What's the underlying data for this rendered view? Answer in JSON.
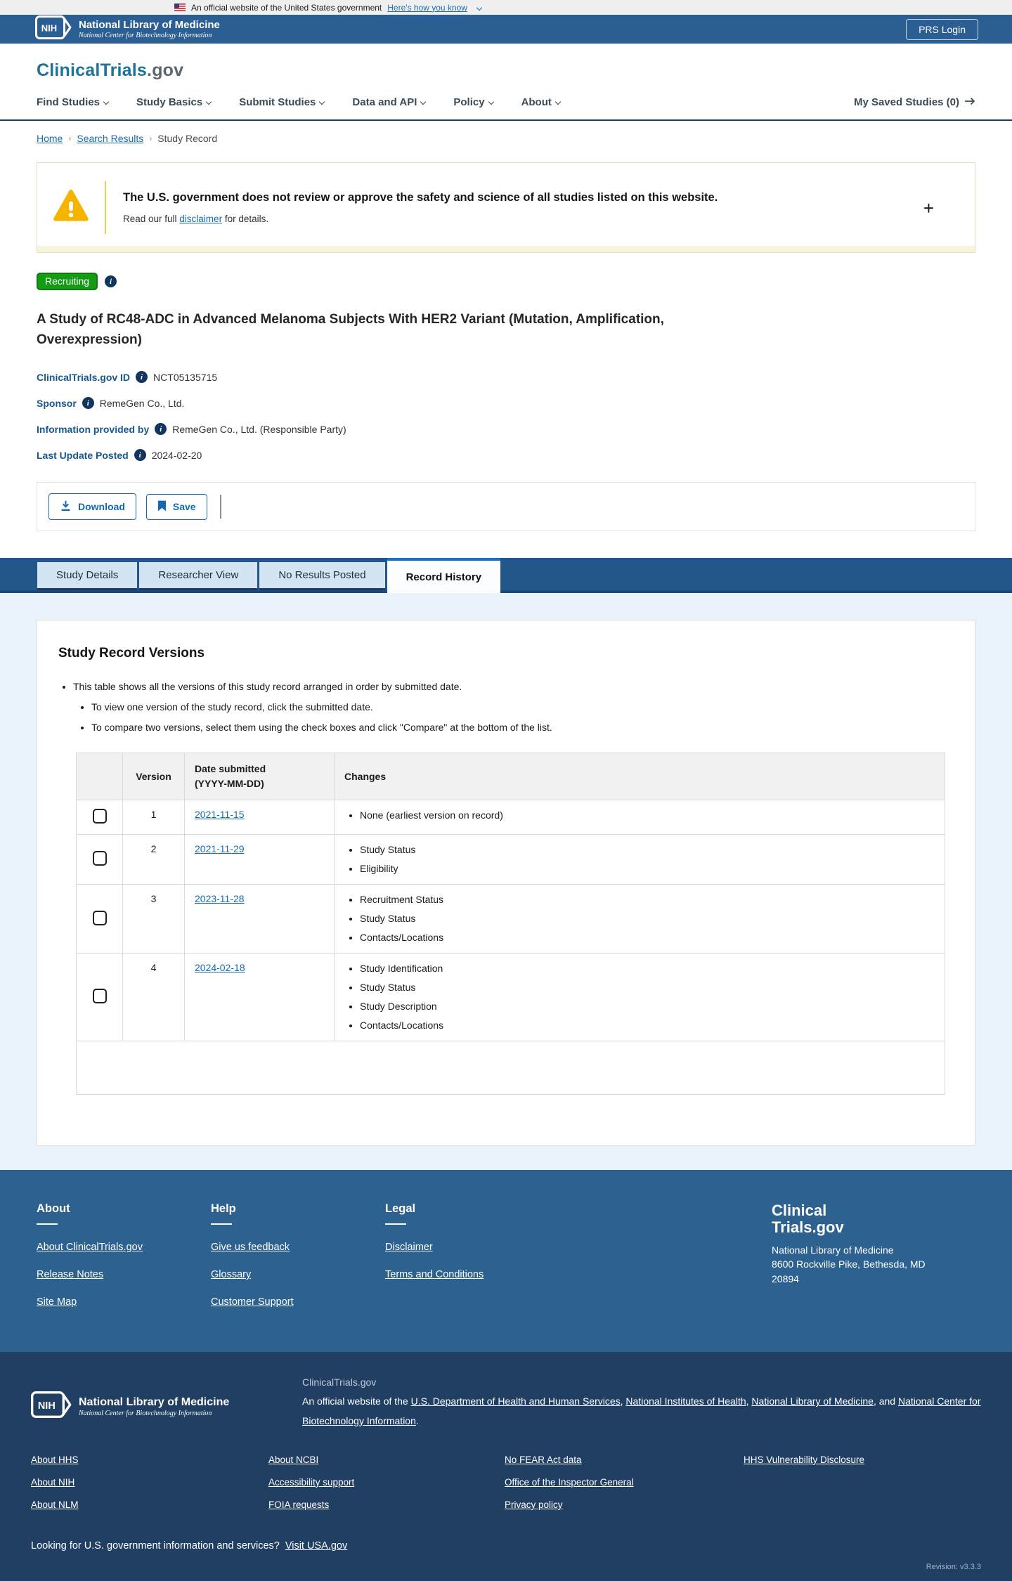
{
  "banner": {
    "text": "An official website of the United States government",
    "link": "Here's how you know"
  },
  "nih_header": {
    "org": "National Library of Medicine",
    "sub": "National Center for Biotechnology Information",
    "login": "PRS Login"
  },
  "brand": {
    "name": "ClinicalTrials",
    "suffix": ".gov"
  },
  "nav": {
    "items": [
      "Find Studies",
      "Study Basics",
      "Submit Studies",
      "Data and API",
      "Policy",
      "About"
    ],
    "saved": "My Saved Studies (0)"
  },
  "breadcrumb": {
    "home": "Home",
    "search": "Search Results",
    "current": "Study Record"
  },
  "alert": {
    "title": "The U.S. government does not review or approve the safety and science of all studies listed on this website.",
    "prefix": "Read our full ",
    "link": "disclaimer",
    "suffix": " for details.",
    "expand": "+"
  },
  "study": {
    "status": "Recruiting",
    "title": "A Study of RC48-ADC in Advanced Melanoma Subjects With HER2 Variant (Mutation, Amplification, Overexpression)",
    "id_label": "ClinicalTrials.gov ID",
    "id_value": "NCT05135715",
    "sponsor_label": "Sponsor",
    "sponsor_value": "RemeGen Co., Ltd.",
    "info_label": "Information provided by",
    "info_value": "RemeGen Co., Ltd. (Responsible Party)",
    "updated_label": "Last Update Posted",
    "updated_value": "2024-02-20"
  },
  "actions": {
    "download": "Download",
    "save": "Save"
  },
  "tabs": {
    "t0": "Study Details",
    "t1": "Researcher View",
    "t2": "No Results Posted",
    "t3": "Record History"
  },
  "record_history": {
    "heading": "Study Record Versions",
    "intro": "This table shows all the versions of this study record arranged in order by submitted date.",
    "sub1": "To view one version of the study record, click the submitted date.",
    "sub2": "To compare two versions, select them using the check boxes and click \"Compare\" at the bottom of the list.",
    "table": {
      "col_version": "Version",
      "col_date_line1": "Date submitted",
      "col_date_line2": "(YYYY-MM-DD)",
      "col_changes": "Changes",
      "rows": [
        {
          "version": "1",
          "date": "2021-11-15",
          "changes": [
            "None (earliest version on record)"
          ]
        },
        {
          "version": "2",
          "date": "2021-11-29",
          "changes": [
            "Study Status",
            "Eligibility"
          ]
        },
        {
          "version": "3",
          "date": "2023-11-28",
          "changes": [
            "Recruitment Status",
            "Study Status",
            "Contacts/Locations"
          ]
        },
        {
          "version": "4",
          "date": "2024-02-18",
          "changes": [
            "Study Identification",
            "Study Status",
            "Study Description",
            "Contacts/Locations"
          ]
        }
      ]
    }
  },
  "footer": {
    "about": {
      "heading": "About",
      "l0": "About ClinicalTrials.gov",
      "l1": "Release Notes",
      "l2": "Site Map"
    },
    "help": {
      "heading": "Help",
      "l0": "Give us feedback",
      "l1": "Glossary",
      "l2": "Customer Support"
    },
    "legal": {
      "heading": "Legal",
      "l0": "Disclaimer",
      "l1": "Terms and Conditions"
    },
    "brand": {
      "line1": "Clinical",
      "line2": "Trials.gov",
      "org": "National Library of Medicine",
      "addr": "8600 Rockville Pike, Bethesda, MD 20894"
    },
    "nlm": {
      "org": "National Library of Medicine",
      "sub": "National Center for Biotechnology Information"
    },
    "statement": {
      "site": "ClinicalTrials.gov",
      "prefix": "An official website of the ",
      "link1": "U.S. Department of Health and Human Services",
      "sep1": ", ",
      "link2": "National Institutes of Health",
      "sep2": ", ",
      "link3": "National Library of Medicine",
      "sep3": ", and ",
      "link4": "National Center for Biotechnology Information",
      "suffix": "."
    },
    "grid": {
      "c0": [
        "About HHS",
        "About NIH",
        "About NLM"
      ],
      "c1": [
        "About NCBI",
        "Accessibility support",
        "FOIA requests"
      ],
      "c2": [
        "No FEAR Act data",
        "Office of the Inspector General",
        "Privacy policy"
      ],
      "c3": [
        "HHS Vulnerability Disclosure"
      ]
    },
    "usa": {
      "text": "Looking for U.S. government information and services?",
      "link": "Visit USA.gov"
    },
    "revision": "Revision: v3.3.3"
  },
  "colors": {
    "accent_blue": "#176bb3",
    "header_blue": "#2b5e93",
    "recruiting_green": "#149b14",
    "footer_navy": "#203f63"
  }
}
